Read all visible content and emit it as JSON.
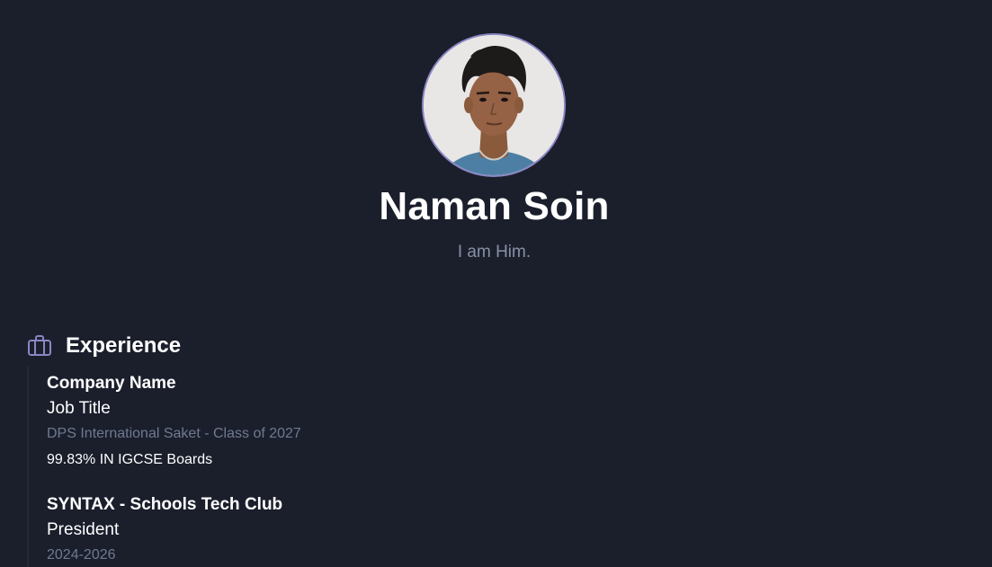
{
  "profile": {
    "name": "Naman Soin",
    "tagline": "I am Him."
  },
  "experience": {
    "heading": "Experience",
    "icon": "briefcase-icon",
    "items": [
      {
        "company": "Company Name",
        "title": "Job Title",
        "meta": "DPS International Saket - Class of 2027",
        "detail": "99.83% IN IGCSE Boards"
      },
      {
        "company": "SYNTAX - Schools Tech Club",
        "title": "President",
        "meta": "2024-2026"
      }
    ]
  },
  "colors": {
    "background": "#1b1f2c",
    "accent": "#8b86c4",
    "muted_text": "#8791a6"
  }
}
